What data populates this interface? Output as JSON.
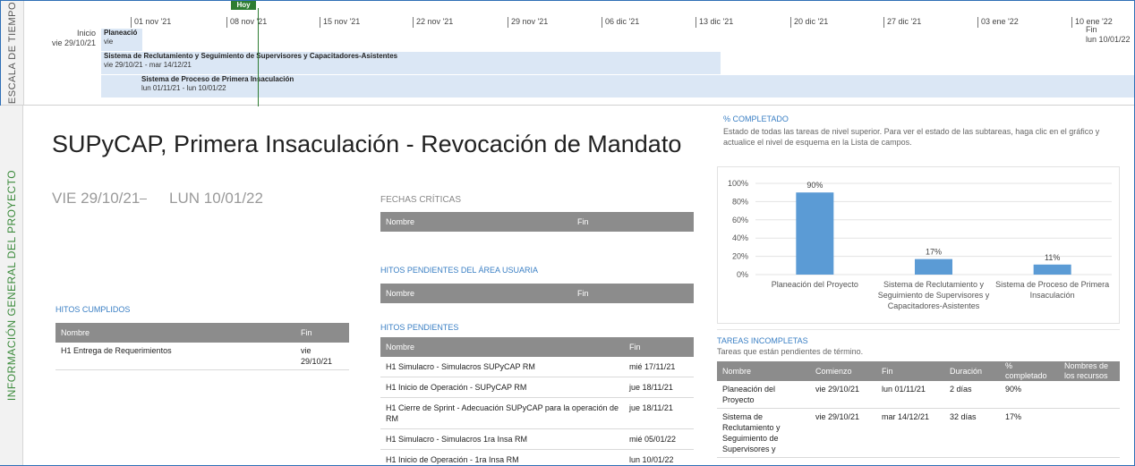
{
  "timeline": {
    "strip_label": "ESCALA DE TIEMPO",
    "ticks": [
      "01 nov '21",
      "08 nov '21",
      "15 nov '21",
      "22 nov '21",
      "29 nov '21",
      "06 dic '21",
      "13 dic '21",
      "20 dic '21",
      "27 dic '21",
      "03 ene '22",
      "10 ene '22"
    ],
    "today_label": "Hoy",
    "start_label": "Inicio",
    "start_date": "vie 29/10/21",
    "end_label": "Fin",
    "end_date": "lun 10/01/22",
    "bars": [
      {
        "name": "Planeació",
        "dates": "vie"
      },
      {
        "name": "Sistema de Reclutamiento y Seguimiento de Supervisores y Capacitadores-Asistentes",
        "dates": "vie 29/10/21 - mar 14/12/21"
      },
      {
        "name": "Sistema de Proceso de Primera Insaculación",
        "dates": "lun 01/11/21 - lun 10/01/22"
      }
    ]
  },
  "overview": {
    "strip_label": "INFORMACIÓN GENERAL DEL PROYECTO",
    "title": "SUPyCAP, Primera Insaculación - Revocación de Mandato",
    "start": "VIE 29/10/21",
    "end": "LUN 10/01/22"
  },
  "hitos_cumplidos": {
    "label": "HITOS CUMPLIDOS",
    "headers": [
      "Nombre",
      "Fin"
    ],
    "rows": [
      [
        "H1 Entrega de Requerimientos",
        "vie 29/10/21"
      ]
    ]
  },
  "fechas_criticas": {
    "label": "FECHAS CRÍTICAS",
    "headers": [
      "Nombre",
      "Fin"
    ]
  },
  "hitos_usuaria": {
    "label": "HITOS PENDIENTES DEL ÁREA USUARIA",
    "headers": [
      "Nombre",
      "Fin"
    ]
  },
  "hitos_pendientes": {
    "label": "HITOS PENDIENTES",
    "headers": [
      "Nombre",
      "Fin"
    ],
    "rows": [
      [
        "H1 Simulacro - Simulacros SUPyCAP RM",
        "mié 17/11/21"
      ],
      [
        "H1 Inicio de Operación - SUPyCAP RM",
        "jue 18/11/21"
      ],
      [
        "H1 Cierre de Sprint - Adecuación SUPyCAP para la operación de RM",
        "jue 18/11/21"
      ],
      [
        "H1 Simulacro - Simulacros 1ra Insa RM",
        "mié 05/01/22"
      ],
      [
        "H1 Inicio de Operación - 1ra Insa RM",
        "lun 10/01/22"
      ]
    ]
  },
  "percent_complete": {
    "label": "% COMPLETADO",
    "description": "Estado de todas las tareas de nivel superior. Para ver el estado de las subtareas, haga clic en el gráfico y actualice el nivel de esquema en la Lista de campos."
  },
  "chart_data": {
    "type": "bar",
    "categories": [
      [
        "Planeación del Proyecto"
      ],
      [
        "Sistema de Reclutamiento y",
        "Seguimiento de Supervisores y",
        "Capacitadores-Asistentes"
      ],
      [
        "Sistema de Proceso de Primera",
        "Insaculación"
      ]
    ],
    "values": [
      90,
      17,
      11
    ],
    "value_labels": [
      "90%",
      "17%",
      "11%"
    ],
    "yticks": [
      "0%",
      "20%",
      "40%",
      "60%",
      "80%",
      "100%"
    ],
    "ylim": [
      0,
      100
    ],
    "bar_color": "#5b9bd5",
    "grid": true
  },
  "tareas_incompletas": {
    "label": "TAREAS INCOMPLETAS",
    "description": "Tareas que están pendientes de término.",
    "headers": [
      "Nombre",
      "Comienzo",
      "Fin",
      "Duración",
      "% completado",
      "Nombres de los recursos"
    ],
    "rows": [
      [
        "Planeación del Proyecto",
        "vie 29/10/21",
        "lun 01/11/21",
        "2 días",
        "90%",
        ""
      ],
      [
        "Sistema de Reclutamiento y Seguimiento de Supervisores y",
        "vie 29/10/21",
        "mar 14/12/21",
        "32 días",
        "17%",
        ""
      ]
    ]
  }
}
